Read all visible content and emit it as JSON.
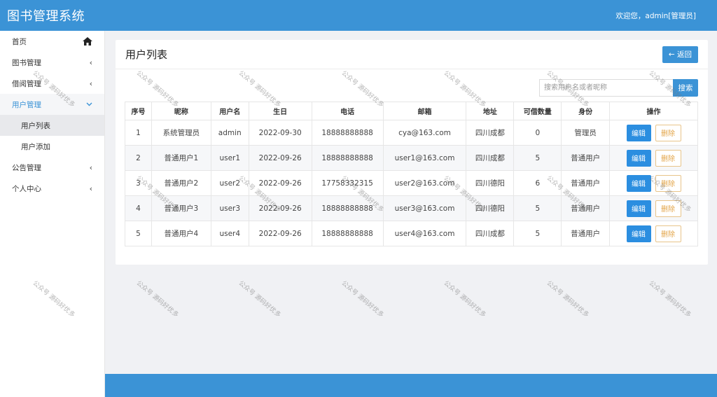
{
  "header": {
    "brand": "图书管理系统",
    "welcome": "欢迎您，admin[管理员]"
  },
  "sidebar": {
    "items": [
      {
        "label": "首页",
        "icon": "home-icon"
      },
      {
        "label": "图书管理",
        "icon": "chevron-left-icon"
      },
      {
        "label": "借阅管理",
        "icon": "chevron-left-icon"
      },
      {
        "label": "用户管理",
        "icon": "chevron-down-icon",
        "expanded": true
      },
      {
        "label": "公告管理",
        "icon": "chevron-left-icon"
      },
      {
        "label": "个人中心",
        "icon": "chevron-left-icon"
      }
    ],
    "sub_items": [
      {
        "label": "用户列表",
        "selected": true
      },
      {
        "label": "用户添加",
        "selected": false
      }
    ]
  },
  "panel": {
    "title": "用户列表",
    "back_label": "← 返回",
    "search_placeholder": "搜索用户名或者昵称",
    "search_label": "搜索"
  },
  "table": {
    "columns": [
      "序号",
      "昵称",
      "用户名",
      "生日",
      "电话",
      "邮箱",
      "地址",
      "可借数量",
      "身份",
      "操作"
    ],
    "rows": [
      [
        "1",
        "系统管理员",
        "admin",
        "2022-09-30",
        "18888888888",
        "cya@163.com",
        "四川成都",
        "0",
        "管理员"
      ],
      [
        "2",
        "普通用户1",
        "user1",
        "2022-09-26",
        "18888888888",
        "user1@163.com",
        "四川成都",
        "5",
        "普通用户"
      ],
      [
        "3",
        "普通用户2",
        "user2",
        "2022-09-26",
        "17758332315",
        "user2@163.com",
        "四川德阳",
        "6",
        "普通用户"
      ],
      [
        "4",
        "普通用户3",
        "user3",
        "2022-09-26",
        "18888888888",
        "user3@163.com",
        "四川德阳",
        "5",
        "普通用户"
      ],
      [
        "5",
        "普通用户4",
        "user4",
        "2022-09-26",
        "18888888888",
        "user4@163.com",
        "四川成都",
        "5",
        "普通用户"
      ]
    ],
    "edit_label": "编辑",
    "delete_label": "删除"
  },
  "watermark": "公众号 源码好优多",
  "colors": {
    "primary": "#3b93d6",
    "edit": "#2b8ee0",
    "delete": "#e3a54a"
  }
}
